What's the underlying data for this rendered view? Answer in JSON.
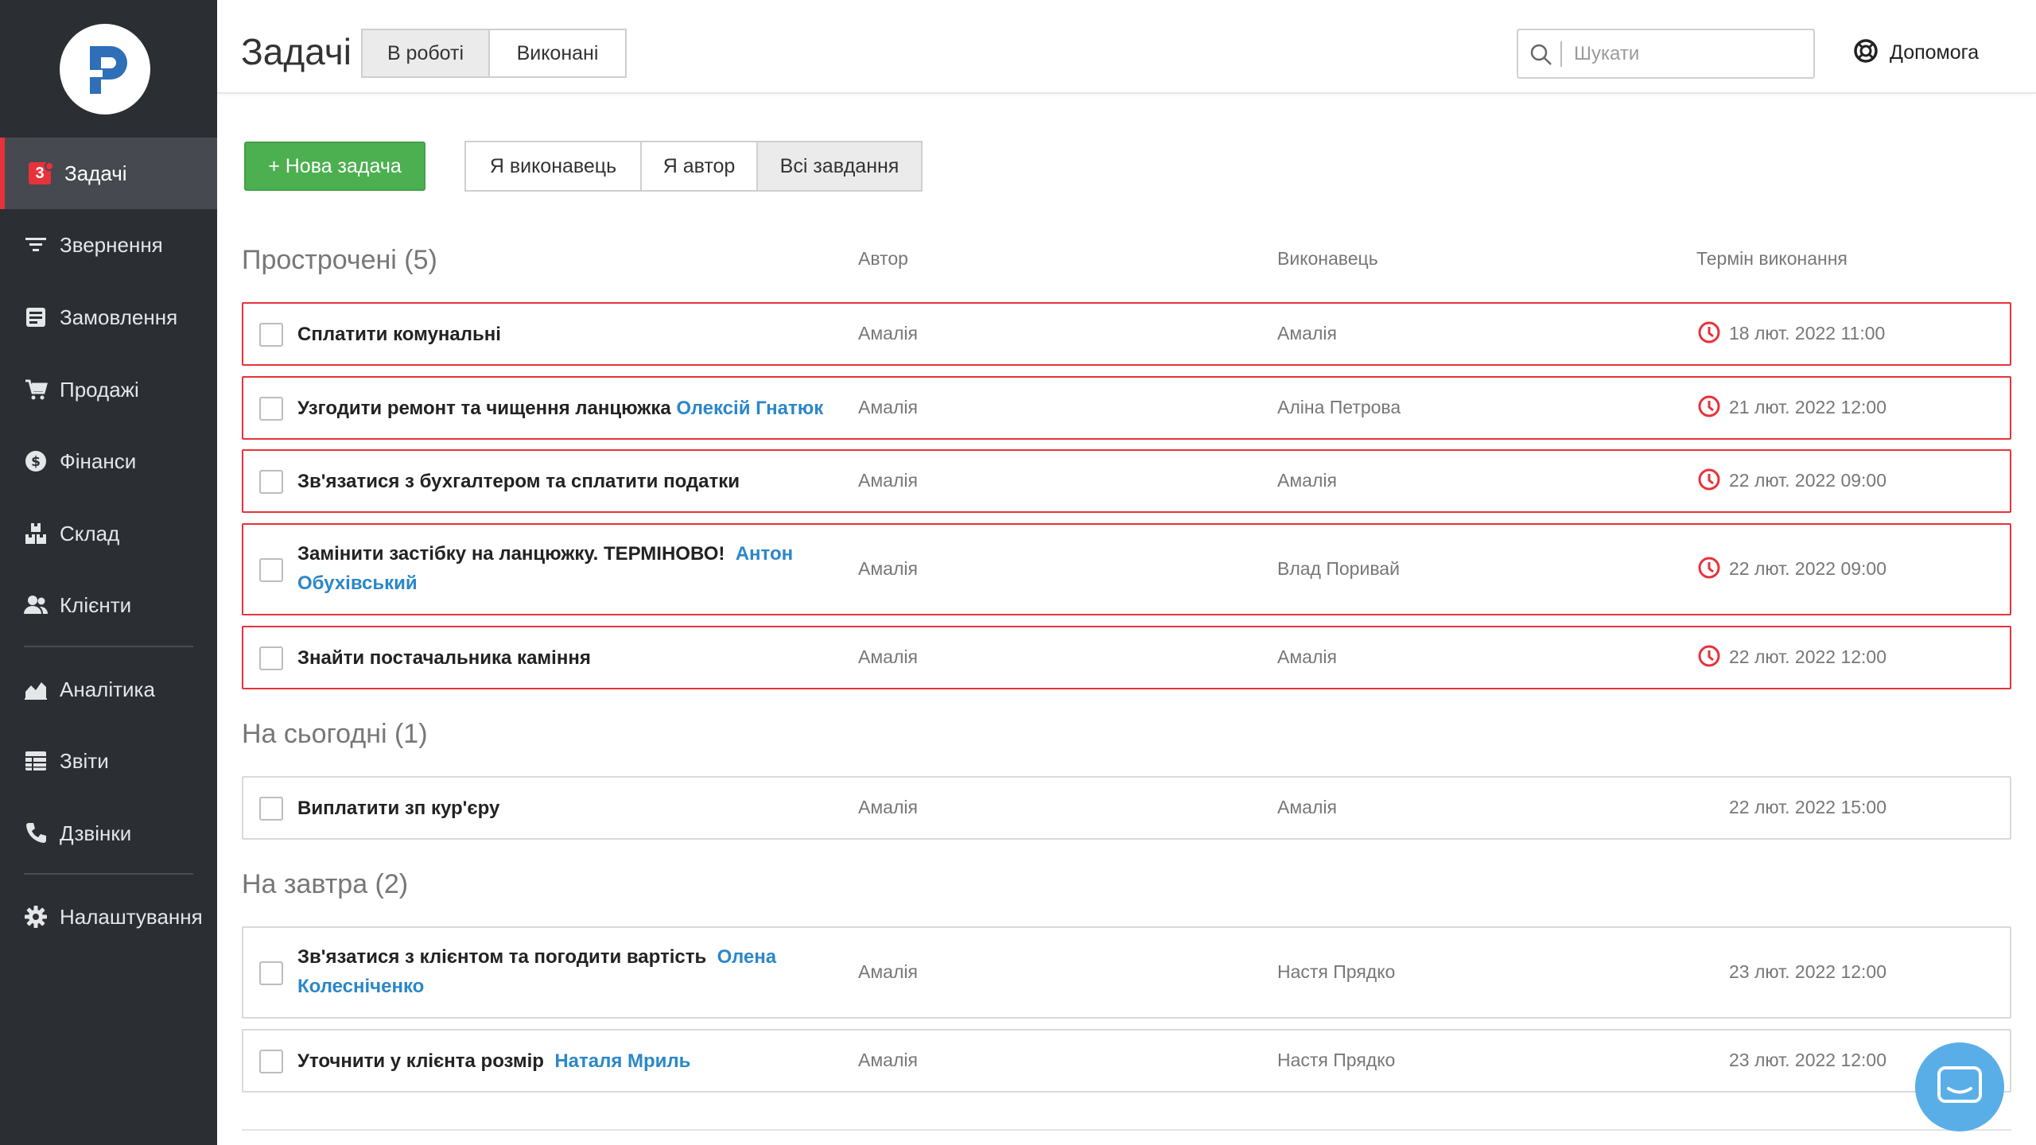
{
  "sidebar": {
    "items": [
      {
        "label": "Задачі",
        "badge": "3",
        "icon": "tasks-icon",
        "active": true
      },
      {
        "label": "Звернення",
        "icon": "funnel-icon"
      },
      {
        "label": "Замовлення",
        "icon": "orders-icon"
      },
      {
        "label": "Продажі",
        "icon": "cart-icon"
      },
      {
        "label": "Фінанси",
        "icon": "dollar-icon"
      },
      {
        "label": "Склад",
        "icon": "boxes-icon"
      },
      {
        "label": "Клієнти",
        "icon": "users-icon"
      },
      {
        "label": "Аналітика",
        "icon": "chart-icon"
      },
      {
        "label": "Звіти",
        "icon": "table-icon"
      },
      {
        "label": "Дзвінки",
        "icon": "phone-icon"
      },
      {
        "label": "Налаштування",
        "icon": "gear-icon"
      }
    ]
  },
  "header": {
    "title": "Задачі",
    "tabs": [
      "В роботі",
      "Виконані"
    ],
    "active_tab": "В роботі",
    "search_placeholder": "Шукати",
    "help_label": "Допомога"
  },
  "toolbar": {
    "new_task_label": "+ Нова задача",
    "filters": [
      "Я виконавець",
      "Я автор",
      "Всі завдання"
    ],
    "active_filter": "Всі завдання"
  },
  "columns": {
    "author": "Автор",
    "assignee": "Виконавець",
    "due": "Термін виконання"
  },
  "sections": [
    {
      "title": "Прострочені (5)",
      "overdue": true,
      "tasks": [
        {
          "title": "Сплатити комунальні",
          "client": "",
          "author": "Амалія",
          "assignee": "Амалія",
          "due": "18 лют. 2022 11:00"
        },
        {
          "title": "Узгодити ремонт та чищення ланцюжка",
          "client": "Олексій Гнатюк",
          "author": "Амалія",
          "assignee": "Аліна Петрова",
          "due": "21 лют. 2022 12:00"
        },
        {
          "title": "Зв'язатися з бухгалтером та сплатити податки",
          "client": "",
          "author": "Амалія",
          "assignee": "Амалія",
          "due": "22 лют. 2022 09:00"
        },
        {
          "title": "Замінити застібку на ланцюжку. ТЕРМІНОВО!",
          "client": "Антон Обухівський",
          "author": "Амалія",
          "assignee": "Влад Поривай",
          "due": "22 лют. 2022 09:00"
        },
        {
          "title": "Знайти постачальника каміння",
          "client": "",
          "author": "Амалія",
          "assignee": "Амалія",
          "due": "22 лют. 2022 12:00"
        }
      ]
    },
    {
      "title": "На сьогодні (1)",
      "overdue": false,
      "tasks": [
        {
          "title": "Виплатити зп кур'єру",
          "client": "",
          "author": "Амалія",
          "assignee": "Амалія",
          "due": "22 лют. 2022 15:00"
        }
      ]
    },
    {
      "title": "На завтра (2)",
      "overdue": false,
      "tasks": [
        {
          "title": "Зв'язатися з клієнтом та погодити вартість",
          "client": "Олена Колесніченко",
          "author": "Амалія",
          "assignee": "Настя Прядко",
          "due": "23 лют. 2022 12:00"
        },
        {
          "title": "Уточнити у клієнта розмір",
          "client": "Наталя Мриль",
          "author": "Амалія",
          "assignee": "Настя Прядко",
          "due": "23 лют. 2022 12:00"
        }
      ]
    }
  ],
  "colors": {
    "accent_green": "#4caf50",
    "overdue_red": "#e8323a",
    "client_link": "#2b87c8",
    "sidebar_bg": "#2b2e33",
    "chat_blue": "#5aaee8"
  },
  "chat_widget_icon": "chat-icon"
}
